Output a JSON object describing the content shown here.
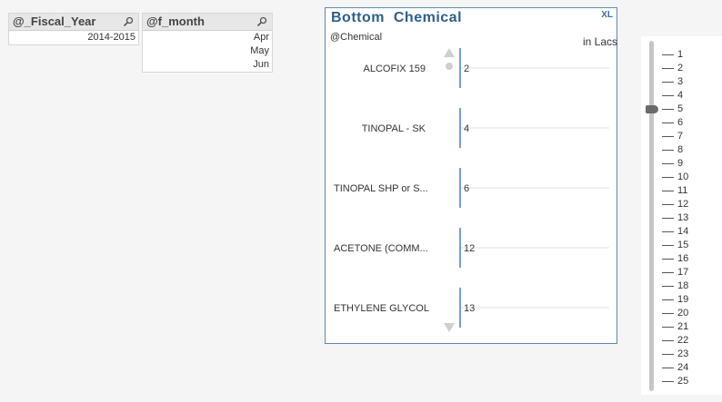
{
  "fiscal_year_listbox": {
    "title": "@_Fiscal_Year",
    "items": [
      "2014-2015"
    ]
  },
  "month_listbox": {
    "title": "@f_month",
    "items": [
      "Apr",
      "May",
      "Jun"
    ]
  },
  "chart": {
    "title": "Bottom  Chemical",
    "xl_label": "XL",
    "dimension_label": "@Chemical",
    "unit_label": "in Lacs",
    "colors": {
      "axis": "#2e6da4",
      "frame": "#5b88b0",
      "grid": "#e2e2e2"
    }
  },
  "chart_data": {
    "type": "bar",
    "categories": [
      "ALCOFIX 159",
      "TINOPAL - SK",
      "TINOPAL SHP or S...",
      "ACETONE (COMM...",
      "ETHYLENE GLYCOL"
    ],
    "values": [
      2,
      4,
      6,
      12,
      13
    ],
    "title": "Bottom  Chemical",
    "xlabel": "@Chemical",
    "ylabel": "in Lacs"
  },
  "slider": {
    "ticks": [
      "1",
      "2",
      "3",
      "4",
      "5",
      "6",
      "7",
      "8",
      "9",
      "10",
      "11",
      "12",
      "13",
      "14",
      "15",
      "16",
      "17",
      "18",
      "19",
      "20",
      "21",
      "22",
      "23",
      "24",
      "25"
    ],
    "selected": 5
  }
}
